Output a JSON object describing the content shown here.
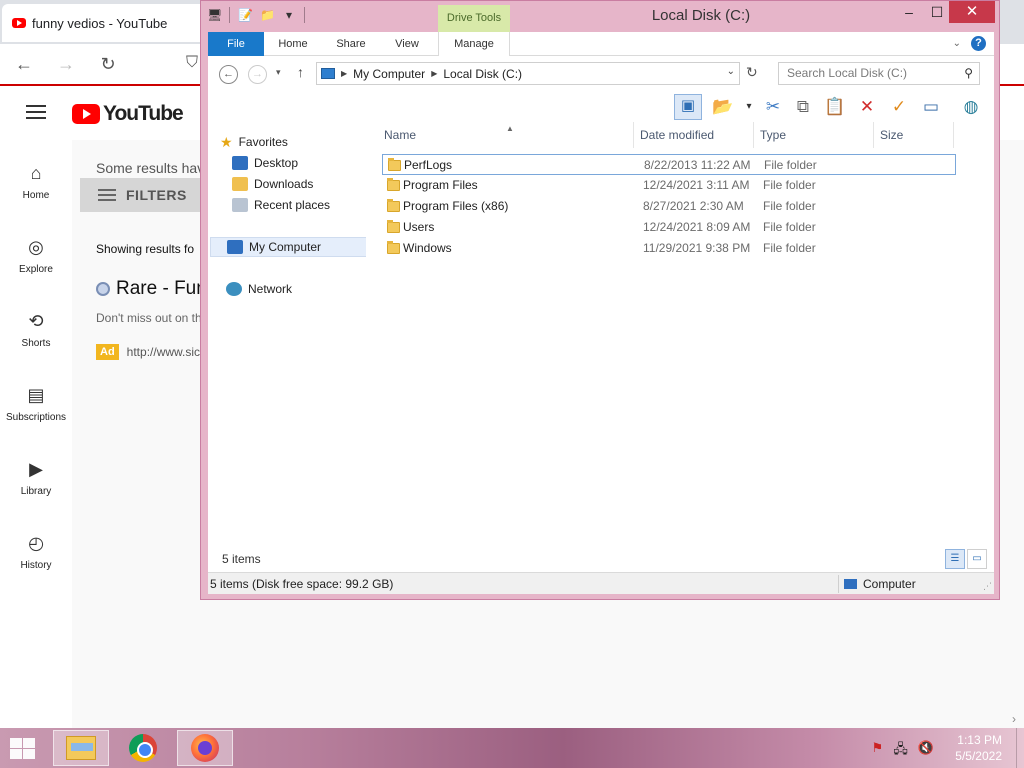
{
  "browser": {
    "tab_title": "funny vedios - YouTube",
    "back_icon": "←",
    "forward_icon": "→",
    "reload_icon": "↻"
  },
  "youtube": {
    "logo_text": "YouTube",
    "sidebar": [
      {
        "label": "Home",
        "icon": "home-icon",
        "glyph": "⌂"
      },
      {
        "label": "Explore",
        "icon": "compass-icon",
        "glyph": "◎"
      },
      {
        "label": "Shorts",
        "icon": "shorts-icon",
        "glyph": "⟲"
      },
      {
        "label": "Subscriptions",
        "icon": "subscriptions-icon",
        "glyph": "▤"
      },
      {
        "label": "Library",
        "icon": "library-icon",
        "glyph": "▶"
      },
      {
        "label": "History",
        "icon": "history-icon",
        "glyph": "◴"
      }
    ],
    "some_results": "Some results hav",
    "filters_label": "FILTERS",
    "showing": "Showing results fo",
    "result_title": "Rare - Funn",
    "result_desc": "Don't miss out on th",
    "ad_badge": "Ad",
    "ad_url": "http://www.sic"
  },
  "explorer": {
    "window_title": "Local Disk (C:)",
    "contextual_tab": "Drive Tools",
    "window_controls": {
      "minimize": "–",
      "maximize": "☐",
      "close": "✕"
    },
    "ribbon_tabs": [
      "File",
      "Home",
      "Share",
      "View",
      "Manage"
    ],
    "breadcrumb": [
      "My Computer",
      "Local Disk (C:)"
    ],
    "search_placeholder": "Search Local Disk (C:)",
    "nav": {
      "favorites": "Favorites",
      "favorites_items": [
        "Desktop",
        "Downloads",
        "Recent places"
      ],
      "computer": "My Computer",
      "network": "Network"
    },
    "columns": [
      "Name",
      "Date modified",
      "Type",
      "Size"
    ],
    "files": [
      {
        "name": "PerfLogs",
        "date": "8/22/2013 11:22 AM",
        "type": "File folder"
      },
      {
        "name": "Program Files",
        "date": "12/24/2021 3:11 AM",
        "type": "File folder"
      },
      {
        "name": "Program Files (x86)",
        "date": "8/27/2021 2:30 AM",
        "type": "File folder"
      },
      {
        "name": "Users",
        "date": "12/24/2021 8:09 AM",
        "type": "File folder"
      },
      {
        "name": "Windows",
        "date": "11/29/2021 9:38 PM",
        "type": "File folder"
      }
    ],
    "item_count": "5 items",
    "status_free": "5 items (Disk free space: 99.2 GB)",
    "status_location": "Computer"
  },
  "taskbar": {
    "time": "1:13 PM",
    "date": "5/5/2022"
  },
  "colors": {
    "window_frame": "#e6b5c9",
    "file_tab": "#1979ca",
    "drive_tools": "#d8e9a9",
    "close_button": "#c7384a",
    "youtube_red": "#ff0000"
  }
}
